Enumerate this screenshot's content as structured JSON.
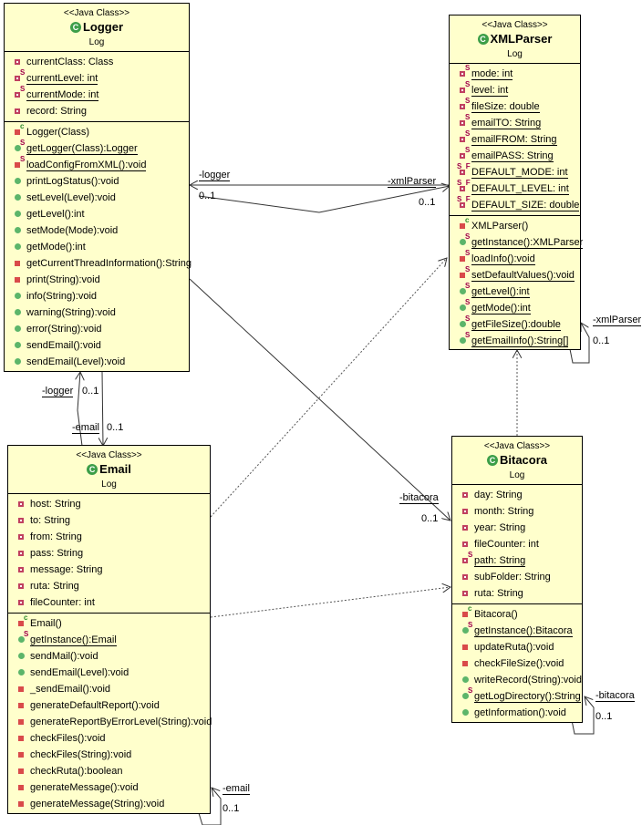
{
  "classes": {
    "logger": {
      "stereotype": "<<Java Class>>",
      "name": "Logger",
      "package": "Log",
      "class_icon": "C",
      "fields": [
        {
          "text": "currentClass: Class",
          "vis": "private",
          "static": false
        },
        {
          "text": "currentLevel: int",
          "vis": "private",
          "static": true
        },
        {
          "text": "currentMode: int",
          "vis": "private",
          "static": true
        },
        {
          "text": "record: String",
          "vis": "private",
          "static": false
        }
      ],
      "methods": [
        {
          "text": "Logger(Class)",
          "vis": "private",
          "ctor": true
        },
        {
          "text": "getLogger(Class):Logger",
          "vis": "public",
          "static": true
        },
        {
          "text": "loadConfigFromXML():void",
          "vis": "private",
          "static": true
        },
        {
          "text": "printLogStatus():void",
          "vis": "public"
        },
        {
          "text": "setLevel(Level):void",
          "vis": "public"
        },
        {
          "text": "getLevel():int",
          "vis": "public"
        },
        {
          "text": "setMode(Mode):void",
          "vis": "public"
        },
        {
          "text": "getMode():int",
          "vis": "public"
        },
        {
          "text": "getCurrentThreadInformation():String",
          "vis": "private"
        },
        {
          "text": "print(String):void",
          "vis": "private"
        },
        {
          "text": "info(String):void",
          "vis": "public"
        },
        {
          "text": "warning(String):void",
          "vis": "public"
        },
        {
          "text": "error(String):void",
          "vis": "public"
        },
        {
          "text": "sendEmail():void",
          "vis": "public"
        },
        {
          "text": "sendEmail(Level):void",
          "vis": "public"
        }
      ]
    },
    "xmlparser": {
      "stereotype": "<<Java Class>>",
      "name": "XMLParser",
      "package": "Log",
      "class_icon": "C",
      "fields": [
        {
          "text": "mode: int",
          "vis": "private",
          "static": true
        },
        {
          "text": "level: int",
          "vis": "private",
          "static": true
        },
        {
          "text": "fileSize: double",
          "vis": "private",
          "static": true
        },
        {
          "text": "emailTO: String",
          "vis": "private",
          "static": true
        },
        {
          "text": "emailFROM: String",
          "vis": "private",
          "static": true
        },
        {
          "text": "emailPASS: String",
          "vis": "private",
          "static": true
        },
        {
          "text": "DEFAULT_MODE: int",
          "vis": "private",
          "static": true,
          "final": true
        },
        {
          "text": "DEFAULT_LEVEL: int",
          "vis": "private",
          "static": true,
          "final": true
        },
        {
          "text": "DEFAULT_SIZE: double",
          "vis": "private",
          "static": true,
          "final": true
        }
      ],
      "methods": [
        {
          "text": "XMLParser()",
          "vis": "private",
          "ctor": true
        },
        {
          "text": "getInstance():XMLParser",
          "vis": "public",
          "static": true
        },
        {
          "text": "loadInfo():void",
          "vis": "private",
          "static": true
        },
        {
          "text": "setDefaultValues():void",
          "vis": "private",
          "static": true
        },
        {
          "text": "getLevel():int",
          "vis": "public",
          "static": true
        },
        {
          "text": "getMode():int",
          "vis": "public",
          "static": true
        },
        {
          "text": "getFileSize():double",
          "vis": "public",
          "static": true
        },
        {
          "text": "getEmailInfo():String[]",
          "vis": "public",
          "static": true
        }
      ]
    },
    "email": {
      "stereotype": "<<Java Class>>",
      "name": "Email",
      "package": "Log",
      "class_icon": "C",
      "fields": [
        {
          "text": "host: String",
          "vis": "private",
          "static": false
        },
        {
          "text": "to: String",
          "vis": "private",
          "static": false
        },
        {
          "text": "from: String",
          "vis": "private",
          "static": false
        },
        {
          "text": "pass: String",
          "vis": "private",
          "static": false
        },
        {
          "text": "message: String",
          "vis": "private",
          "static": false
        },
        {
          "text": "ruta: String",
          "vis": "private",
          "static": false
        },
        {
          "text": "fileCounter: int",
          "vis": "private",
          "static": false
        }
      ],
      "methods": [
        {
          "text": "Email()",
          "vis": "private",
          "ctor": true
        },
        {
          "text": "getInstance():Email",
          "vis": "public",
          "static": true
        },
        {
          "text": "sendMail():void",
          "vis": "public"
        },
        {
          "text": "sendEmail(Level):void",
          "vis": "public"
        },
        {
          "text": "_sendEmail():void",
          "vis": "private"
        },
        {
          "text": "generateDefaultReport():void",
          "vis": "private"
        },
        {
          "text": "generateReportByErrorLevel(String):void",
          "vis": "private"
        },
        {
          "text": "checkFiles():void",
          "vis": "private"
        },
        {
          "text": "checkFiles(String):void",
          "vis": "private"
        },
        {
          "text": "checkRuta():boolean",
          "vis": "private"
        },
        {
          "text": "generateMessage():void",
          "vis": "private"
        },
        {
          "text": "generateMessage(String):void",
          "vis": "private"
        }
      ]
    },
    "bitacora": {
      "stereotype": "<<Java Class>>",
      "name": "Bitacora",
      "package": "Log",
      "class_icon": "C",
      "fields": [
        {
          "text": "day: String",
          "vis": "private",
          "static": false
        },
        {
          "text": "month: String",
          "vis": "private",
          "static": false
        },
        {
          "text": "year: String",
          "vis": "private",
          "static": false
        },
        {
          "text": "fileCounter: int",
          "vis": "private",
          "static": false
        },
        {
          "text": "path: String",
          "vis": "private",
          "static": true
        },
        {
          "text": "subFolder: String",
          "vis": "private",
          "static": false
        },
        {
          "text": "ruta: String",
          "vis": "private",
          "static": false
        }
      ],
      "methods": [
        {
          "text": "Bitacora()",
          "vis": "private",
          "ctor": true
        },
        {
          "text": "getInstance():Bitacora",
          "vis": "public",
          "static": true
        },
        {
          "text": "updateRuta():void",
          "vis": "private"
        },
        {
          "text": "checkFileSize():void",
          "vis": "private"
        },
        {
          "text": "writeRecord(String):void",
          "vis": "public"
        },
        {
          "text": "getLogDirectory():String",
          "vis": "public",
          "static": true
        },
        {
          "text": "getInformation():void",
          "vis": "public"
        }
      ]
    }
  },
  "associations": {
    "logger_to_xml_role": "-xmlParser",
    "logger_to_xml_mult": "0..1",
    "xml_to_logger_role": "-logger",
    "xml_to_logger_mult": "0..1",
    "email_to_logger_role": "-logger",
    "email_to_logger_mult": "0..1",
    "logger_to_email_role": "-email",
    "logger_to_email_mult": "0..1",
    "logger_to_bitacora_role": "-bitacora",
    "logger_to_bitacora_mult": "0..1",
    "xml_self_role": "-xmlParser",
    "xml_self_mult": "0..1",
    "bitacora_self_role": "-bitacora",
    "bitacora_self_mult": "0..1",
    "email_self_role": "-email",
    "email_self_mult": "0..1"
  },
  "modifier_glyphs": {
    "static": "S",
    "ctor": "C",
    "final": "F"
  }
}
